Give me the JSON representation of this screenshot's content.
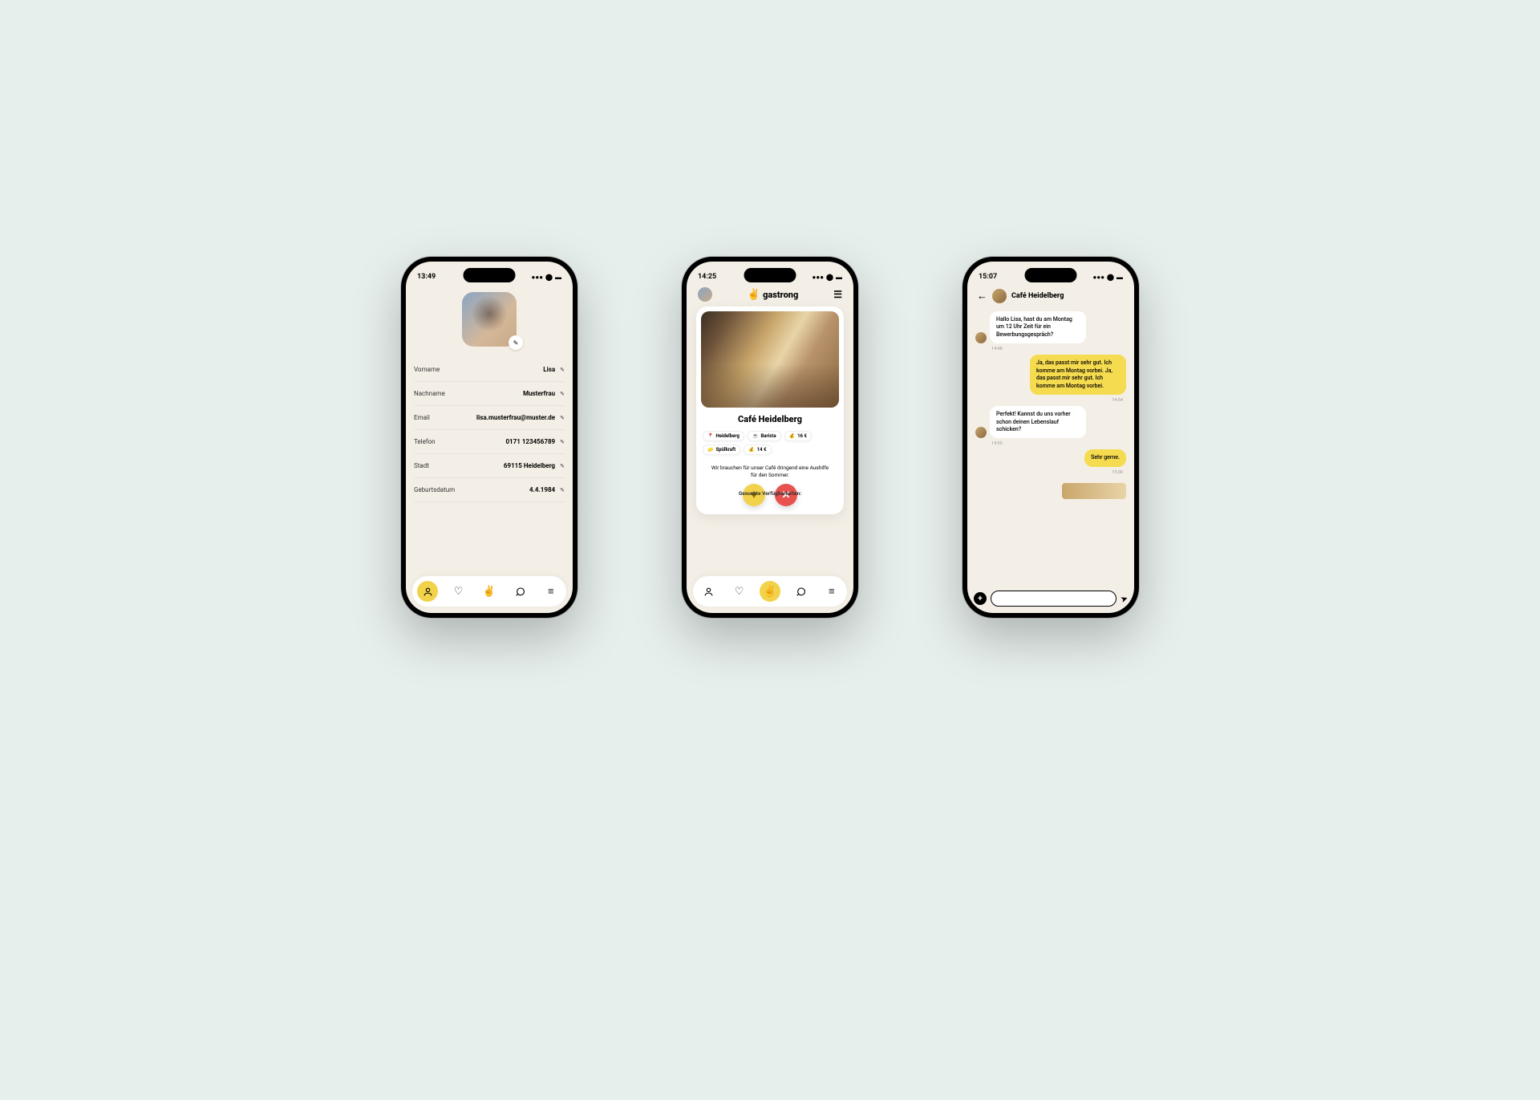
{
  "status": {
    "signal": "▬▮▮▮",
    "wifi": "◕",
    "battery": "▮▮"
  },
  "phone1": {
    "time": "13:49",
    "fields": [
      {
        "label": "Vorname",
        "value": "Lisa"
      },
      {
        "label": "Nachname",
        "value": "Musterfrau"
      },
      {
        "label": "Email",
        "value": "lisa.musterfrau@muster.de"
      },
      {
        "label": "Telefon",
        "value": "0171 123456789"
      },
      {
        "label": "Stadt",
        "value": "69115 Heidelberg"
      },
      {
        "label": "Geburtsdatum",
        "value": "4.4.1984"
      }
    ]
  },
  "phone2": {
    "time": "14:25",
    "brand": "gastrong",
    "card_title": "Café Heidelberg",
    "pills": [
      {
        "icon": "📍",
        "text": "Heidelberg"
      },
      {
        "icon": "☕",
        "text": "Barista"
      },
      {
        "icon": "💰",
        "text": "16 €"
      },
      {
        "icon": "🧽",
        "text": "Spülkraft"
      },
      {
        "icon": "💰",
        "text": "14 €"
      }
    ],
    "desc": "Wir brauchen für unser Café dringend eine Aushilfe für den Sommer.",
    "cut": "Gesuchte Verfügbarkeiten:"
  },
  "phone3": {
    "time": "15:07",
    "chat_title": "Café Heidelberg",
    "m1": "Hallo Lisa, hast du am Montag um 12 Uhr Zeit für ein Bewerbungsgespräch?",
    "t1": "14:48",
    "m2": "Ja, das passt mir sehr gut. Ich komme am Montag vorbei. Ja, das passt mir sehr gut. Ich komme am Montag vorbei.",
    "t2": "14:54",
    "m3": "Perfekt! Kannst du uns vorher schon deinen Lebenslauf schicken?",
    "t3": "14:55",
    "m4": "Sehr gerne.",
    "t4": "15:00"
  }
}
